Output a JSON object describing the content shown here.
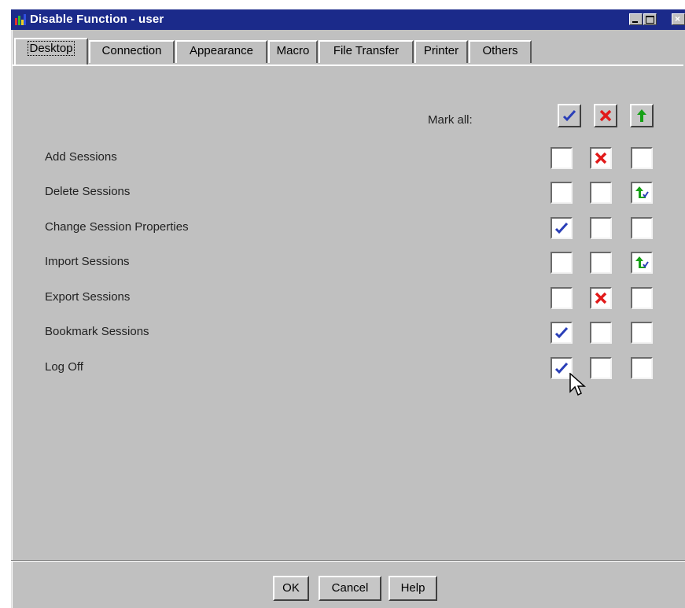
{
  "window": {
    "title": "Disable Function - user"
  },
  "tabs": [
    {
      "label": "Desktop",
      "active": true
    },
    {
      "label": "Connection",
      "active": false
    },
    {
      "label": "Appearance",
      "active": false
    },
    {
      "label": "Macro",
      "active": false
    },
    {
      "label": "File Transfer",
      "active": false
    },
    {
      "label": "Printer",
      "active": false
    },
    {
      "label": "Others",
      "active": false
    }
  ],
  "mark_all": {
    "label": "Mark all:",
    "buttons": [
      "check-icon",
      "x-icon",
      "up-arrow-icon"
    ]
  },
  "rows": [
    {
      "label": "Add Sessions",
      "state": [
        false,
        true,
        false
      ]
    },
    {
      "label": "Delete Sessions",
      "state": [
        false,
        false,
        true
      ]
    },
    {
      "label": "Change Session Properties",
      "state": [
        true,
        false,
        false
      ]
    },
    {
      "label": "Import Sessions",
      "state": [
        false,
        false,
        true
      ]
    },
    {
      "label": "Export Sessions",
      "state": [
        false,
        true,
        false
      ]
    },
    {
      "label": "Bookmark Sessions",
      "state": [
        true,
        false,
        false
      ]
    },
    {
      "label": "Log Off",
      "state": [
        true,
        false,
        false
      ]
    }
  ],
  "buttons": {
    "ok": "OK",
    "cancel": "Cancel",
    "help": "Help"
  },
  "colors": {
    "titlebar": "#1b2a8a",
    "check": "#2a3fb8",
    "cross": "#e21a1a",
    "arrow": "#16a016",
    "face": "#c0c0c0"
  }
}
